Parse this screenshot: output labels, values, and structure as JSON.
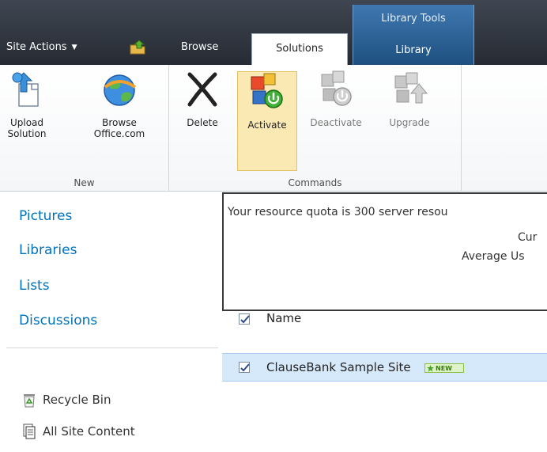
{
  "header": {
    "site_actions": "Site Actions",
    "library_tools_label": "Library Tools",
    "tabs": [
      {
        "label": "Browse"
      },
      {
        "label": "Solutions"
      },
      {
        "label": "Library"
      }
    ]
  },
  "ribbon": {
    "groups": {
      "new": "New",
      "commands": "Commands"
    },
    "buttons": {
      "upload_line1": "Upload",
      "upload_line2": "Solution",
      "browse_line1": "Browse",
      "browse_line2": "Office.com",
      "delete": "Delete",
      "activate": "Activate",
      "deactivate": "Deactivate",
      "upgrade": "Upgrade"
    }
  },
  "leftnav": {
    "links": [
      "Pictures",
      "Libraries",
      "Lists",
      "Discussions"
    ],
    "recycle_bin": "Recycle Bin",
    "all_site_content": "All Site Content"
  },
  "main": {
    "quota_line1": "Your resource quota is 300 server resou",
    "quota_line2": "Cur",
    "quota_line3": "Average Us",
    "column_name": "Name",
    "rows": [
      {
        "name": "ClauseBank Sample Site",
        "badge": "NEW"
      }
    ]
  },
  "colors": {
    "link": "#0072bc",
    "topbar": "#262b33",
    "selected_row": "#d5e9fb",
    "activate_highlight": "#fbe9b4"
  }
}
